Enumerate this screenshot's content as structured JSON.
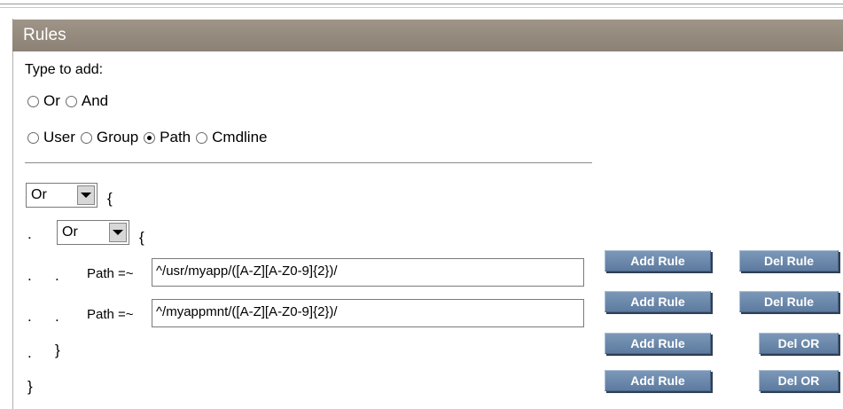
{
  "panel": {
    "title": "Rules"
  },
  "type_to_add": {
    "label": "Type to add:",
    "logic_options": [
      {
        "label": "Or",
        "checked": false
      },
      {
        "label": "And",
        "checked": false
      }
    ],
    "field_options": [
      {
        "label": "User",
        "checked": false
      },
      {
        "label": "Group",
        "checked": false
      },
      {
        "label": "Path",
        "checked": true
      },
      {
        "label": "Cmdline",
        "checked": false
      }
    ]
  },
  "tree": {
    "outer_operator": "Or",
    "inner_operator": "Or",
    "open_brace": "{",
    "close_brace": "}",
    "indent_dot": ".",
    "rules": [
      {
        "label": "Path =~",
        "value": "^/usr/myapp/([A-Z][A-Z0-9]{2})/"
      },
      {
        "label": "Path =~",
        "value": "^/myappmnt/([A-Z][A-Z0-9]{2})/"
      }
    ]
  },
  "buttons": {
    "add_rule": "Add Rule",
    "del_rule": "Del Rule",
    "del_or": "Del OR"
  }
}
